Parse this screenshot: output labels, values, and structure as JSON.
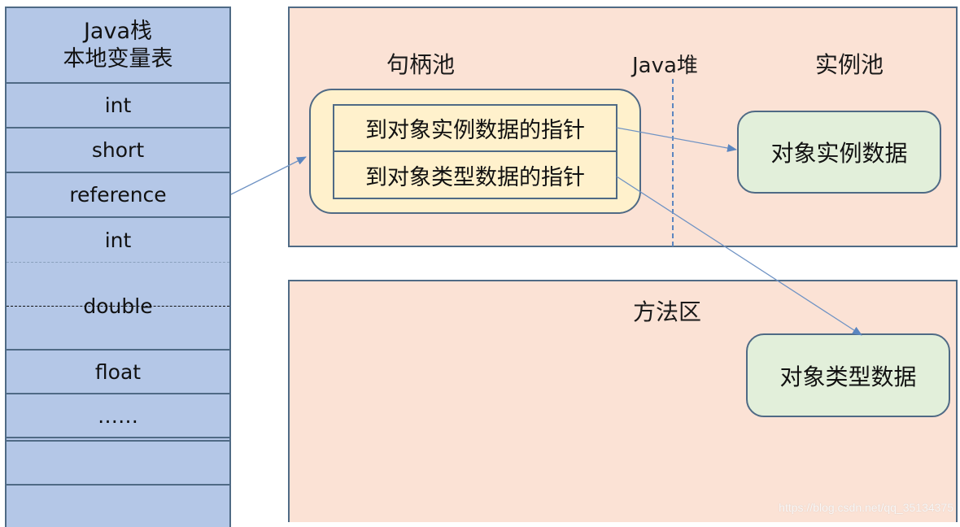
{
  "stack": {
    "title_line1": "Java栈",
    "title_line2": "本地变量表",
    "slots": [
      "int",
      "short",
      "reference",
      "int",
      "double",
      "float",
      "……",
      "",
      ""
    ]
  },
  "heap": {
    "handle_pool_label": "句柄池",
    "heap_label": "Java堆",
    "instance_pool_label": "实例池",
    "pointers": [
      "到对象实例数据的指针",
      "到对象类型数据的指针"
    ],
    "instance_data_label": "对象实例数据"
  },
  "method_area": {
    "label": "方法区",
    "type_data_label": "对象类型数据"
  },
  "connections": [
    {
      "from": "reference",
      "to": "句柄池"
    },
    {
      "from": "到对象实例数据的指针",
      "to": "对象实例数据"
    },
    {
      "from": "到对象类型数据的指针",
      "to": "对象类型数据"
    }
  ],
  "colors": {
    "stack_fill": "#b4c7e7",
    "panel_fill": "#fbe2d5",
    "handle_pool_fill": "#fff1cc",
    "data_box_fill": "#e2efda",
    "border": "#4f6a85",
    "arrow": "#5b86c0"
  },
  "watermark": "https://blog.csdn.net/qq_35134375"
}
